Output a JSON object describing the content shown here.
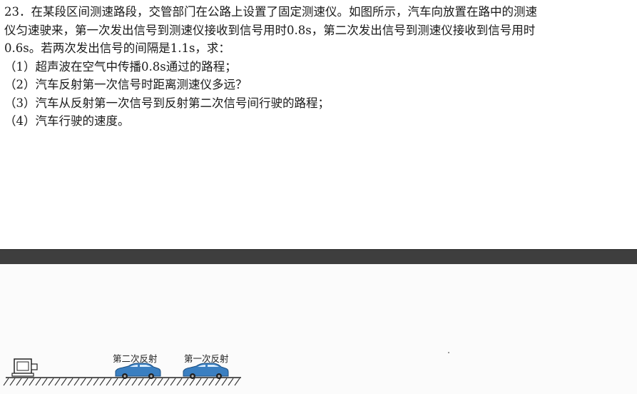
{
  "problem": {
    "lines": [
      "23．在某段区间测速路段，交管部门在公路上设置了固定测速仪。如图所示，汽车向放置在路中的测速",
      "仪匀速驶来，第一次发出信号到测速仪接收到信号用时0.8s，第二次发出信号到测速仪接收到信号用时",
      "0.6s。若两次发出信号的间隔是1.1s，求：",
      "（1）超声波在空气中传播0.8s通过的路程；",
      "（2）汽车反射第一次信号时距离测速仪多远？",
      "（3）汽车从反射第一次信号到反射第二次信号间行驶的路程；",
      "（4）汽车行驶的速度。"
    ]
  },
  "figure": {
    "second_reflection_label": "第二次反射",
    "first_reflection_label": "第一次反射",
    "car_color": "#3a7fc1",
    "device_icon": "speed-camera-icon",
    "car_icon": "car-icon"
  }
}
